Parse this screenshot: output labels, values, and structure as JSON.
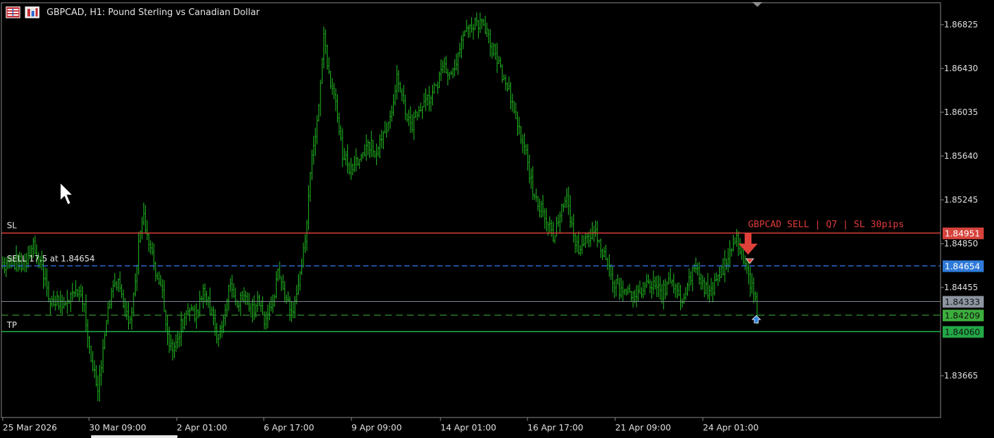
{
  "header": {
    "symbol_title": "GBPCAD, H1:  Pound Sterling vs Canadian Dollar"
  },
  "icons": {
    "grid": "chart-grid-icon",
    "symbol": "symbol-properties-icon",
    "cursor": "mouse-cursor-icon"
  },
  "colors": {
    "background": "#000000",
    "candle": "#22c322",
    "sl_line": "#e0403a",
    "entry_line": "#2f6ad8",
    "bid_line": "#7f8b99",
    "tp_line": "#22b84a",
    "dashed_green": "#2c7d2c",
    "signal_text": "#e23b3b"
  },
  "chart_data": {
    "type": "candlestick",
    "symbol": "GBPCAD",
    "timeframe": "H1",
    "ylim": [
      1.833,
      1.8708
    ],
    "y_ticks": [
      "1.86825",
      "1.86430",
      "1.86035",
      "1.85640",
      "1.85245",
      "1.84850",
      "1.84455",
      "1.83665"
    ],
    "x_ticks": [
      "25 Mar 2026",
      "30 Mar 09:00",
      "2 Apr 01:00",
      "6 Apr 17:00",
      "9 Apr 09:00",
      "14 Apr 01:00",
      "16 Apr 17:00",
      "21 Apr 09:00",
      "24 Apr 01:00"
    ],
    "anchors": [
      [
        0,
        1.8465
      ],
      [
        6,
        1.8468
      ],
      [
        10,
        1.8468
      ],
      [
        14,
        1.8464
      ],
      [
        18,
        1.8482
      ],
      [
        20,
        1.8476
      ],
      [
        24,
        1.8455
      ],
      [
        28,
        1.8435
      ],
      [
        32,
        1.8433
      ],
      [
        36,
        1.8428
      ],
      [
        40,
        1.844
      ],
      [
        44,
        1.8442
      ],
      [
        48,
        1.8426
      ],
      [
        50,
        1.8402
      ],
      [
        53,
        1.8375
      ],
      [
        56,
        1.8352
      ],
      [
        60,
        1.84
      ],
      [
        64,
        1.8445
      ],
      [
        68,
        1.8448
      ],
      [
        72,
        1.842
      ],
      [
        76,
        1.8418
      ],
      [
        80,
        1.8488
      ],
      [
        83,
        1.8512
      ],
      [
        86,
        1.8482
      ],
      [
        90,
        1.8462
      ],
      [
        94,
        1.8438
      ],
      [
        98,
        1.8388
      ],
      [
        102,
        1.8398
      ],
      [
        106,
        1.8414
      ],
      [
        110,
        1.8425
      ],
      [
        114,
        1.8421
      ],
      [
        118,
        1.8441
      ],
      [
        122,
        1.8426
      ],
      [
        126,
        1.8402
      ],
      [
        130,
        1.842
      ],
      [
        134,
        1.8451
      ],
      [
        138,
        1.843
      ],
      [
        142,
        1.8438
      ],
      [
        146,
        1.8421
      ],
      [
        150,
        1.8433
      ],
      [
        154,
        1.8418
      ],
      [
        158,
        1.8423
      ],
      [
        162,
        1.8458
      ],
      [
        166,
        1.844
      ],
      [
        170,
        1.8422
      ],
      [
        174,
        1.8445
      ],
      [
        178,
        1.8492
      ],
      [
        182,
        1.856
      ],
      [
        186,
        1.861
      ],
      [
        189,
        1.8672
      ],
      [
        192,
        1.8638
      ],
      [
        196,
        1.8608
      ],
      [
        200,
        1.8565
      ],
      [
        204,
        1.8553
      ],
      [
        208,
        1.8556
      ],
      [
        212,
        1.8568
      ],
      [
        216,
        1.8575
      ],
      [
        220,
        1.8566
      ],
      [
        224,
        1.8585
      ],
      [
        228,
        1.8598
      ],
      [
        232,
        1.8632
      ],
      [
        236,
        1.8608
      ],
      [
        240,
        1.859
      ],
      [
        244,
        1.8603
      ],
      [
        248,
        1.8615
      ],
      [
        252,
        1.8618
      ],
      [
        256,
        1.863
      ],
      [
        260,
        1.8643
      ],
      [
        264,
        1.864
      ],
      [
        268,
        1.8655
      ],
      [
        272,
        1.8672
      ],
      [
        276,
        1.868
      ],
      [
        280,
        1.8684
      ],
      [
        284,
        1.8678
      ],
      [
        288,
        1.8662
      ],
      [
        292,
        1.8645
      ],
      [
        296,
        1.863
      ],
      [
        300,
        1.8613
      ],
      [
        304,
        1.859
      ],
      [
        308,
        1.8565
      ],
      [
        312,
        1.8535
      ],
      [
        316,
        1.852
      ],
      [
        320,
        1.851
      ],
      [
        324,
        1.849
      ],
      [
        328,
        1.8515
      ],
      [
        332,
        1.853
      ],
      [
        336,
        1.849
      ],
      [
        340,
        1.8475
      ],
      [
        344,
        1.849
      ],
      [
        348,
        1.85
      ],
      [
        352,
        1.848
      ],
      [
        356,
        1.8465
      ],
      [
        360,
        1.845
      ],
      [
        364,
        1.8442
      ],
      [
        368,
        1.8445
      ],
      [
        372,
        1.8435
      ],
      [
        376,
        1.844
      ],
      [
        380,
        1.845
      ],
      [
        384,
        1.8445
      ],
      [
        388,
        1.844
      ],
      [
        392,
        1.8448
      ],
      [
        396,
        1.8445
      ],
      [
        400,
        1.8435
      ],
      [
        404,
        1.8452
      ],
      [
        408,
        1.8462
      ],
      [
        412,
        1.8448
      ],
      [
        416,
        1.844
      ],
      [
        420,
        1.845
      ],
      [
        424,
        1.8462
      ],
      [
        428,
        1.8478
      ],
      [
        432,
        1.8488
      ],
      [
        436,
        1.847
      ],
      [
        440,
        1.845
      ],
      [
        442,
        1.844
      ],
      [
        444,
        1.8425
      ]
    ],
    "bars": 445,
    "levels": {
      "sl": 1.84951,
      "entry": 1.84654,
      "bid": 1.84333,
      "ask_dashed": 1.84209,
      "tp": 1.8406
    },
    "level_labels": {
      "sl": "1.84951",
      "entry": "1.84654",
      "bid": "1.84333",
      "ask_dashed": "1.84209",
      "tp": "1.84060"
    },
    "line_labels": {
      "sl": "SL",
      "entry": "SELL 17.5 at 1.84654",
      "tp": "TP"
    },
    "signal_text": "GBPCAD SELL | Q7 | SL 30pips"
  }
}
